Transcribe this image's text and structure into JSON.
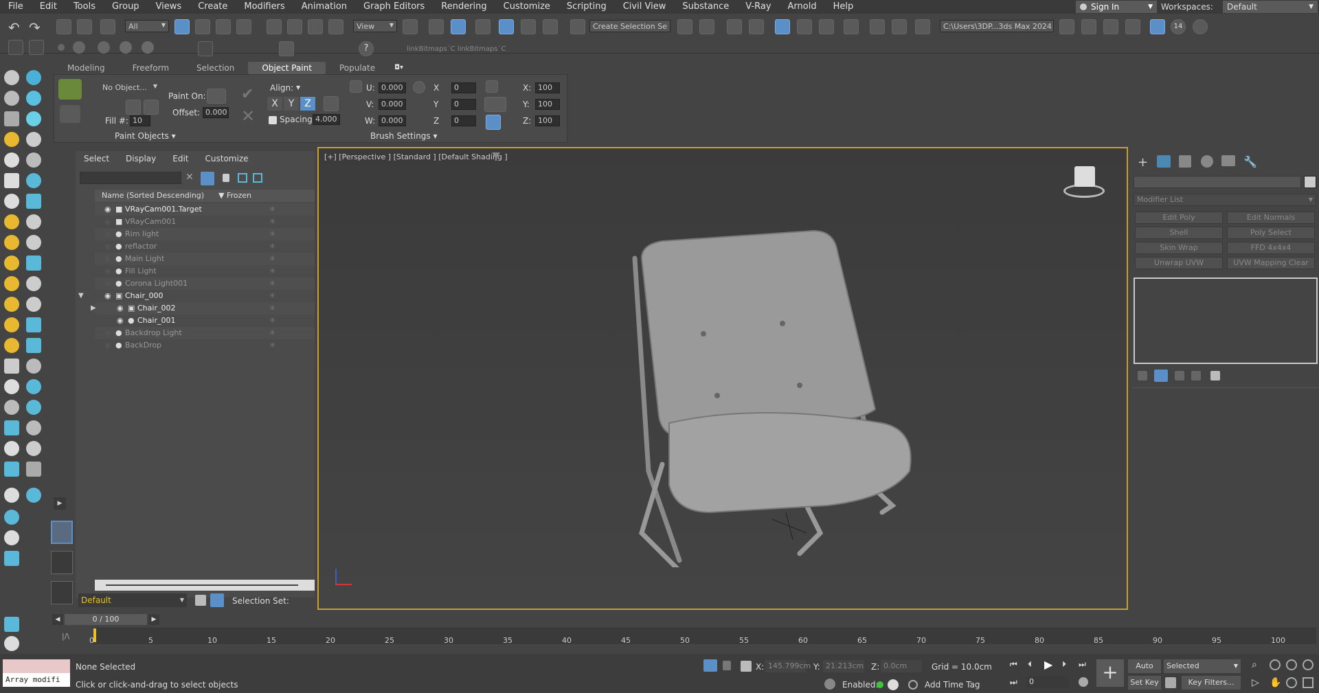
{
  "menu": [
    "File",
    "Edit",
    "Tools",
    "Group",
    "Views",
    "Create",
    "Modifiers",
    "Animation",
    "Graph Editors",
    "Rendering",
    "Customize",
    "Scripting",
    "Civil View",
    "Substance",
    "V-Ray",
    "Arnold",
    "Help"
  ],
  "account": {
    "sign_in": "Sign In",
    "workspaces_label": "Workspaces:",
    "workspace": "Default"
  },
  "toolbar": {
    "filter": "All",
    "view": "View",
    "selection_set": "Create Selection Se",
    "path": "C:\\Users\\3DP...3ds Max 2024",
    "link_bitmaps": "linkBitmaps´C linkBitmaps´C",
    "count_badge": "14"
  },
  "ribbon": {
    "tabs": [
      "Modeling",
      "Freeform",
      "Selection",
      "Object Paint",
      "Populate"
    ],
    "no_object": "No Object...",
    "paint_on": "Paint On:",
    "offset_label": "Offset:",
    "offset": "0.000",
    "fill_label": "Fill #:",
    "fill": "10",
    "align_label": "Align:",
    "axes": [
      "X",
      "Y",
      "Z"
    ],
    "spacing_label": "Spacing:",
    "spacing": "4.000",
    "u_label": "U:",
    "u": "0.000",
    "v_label": "V:",
    "v": "0.000",
    "w_label": "W:",
    "w": "0.000",
    "x_label": "X",
    "x": "0",
    "y_label": "Y",
    "y": "0",
    "z_label": "Z",
    "z": "0",
    "sx_label": "X:",
    "sx": "100",
    "sy_label": "Y:",
    "sy": "100",
    "sz_label": "Z:",
    "sz": "100",
    "paint_objects": "Paint Objects ▾",
    "brush_settings": "Brush Settings ▾"
  },
  "explorer": {
    "menus": [
      "Select",
      "Display",
      "Edit",
      "Customize"
    ],
    "col_name": "Name (Sorted Descending)",
    "col_frozen": "▼ Frozen",
    "rows": [
      {
        "name": "VRayCam001.Target",
        "bright": true
      },
      {
        "name": "VRayCam001",
        "bright": false
      },
      {
        "name": "Rim light",
        "bright": false
      },
      {
        "name": "reflactor",
        "bright": false
      },
      {
        "name": "Main Light",
        "bright": false
      },
      {
        "name": "Fill Light",
        "bright": false
      },
      {
        "name": "Corona Light001",
        "bright": false
      },
      {
        "name": "Chair_000",
        "bright": true
      },
      {
        "name": "Chair_002",
        "bright": true
      },
      {
        "name": "Chair_001",
        "bright": true
      },
      {
        "name": "Backdrop Light",
        "bright": false
      },
      {
        "name": "BackDrop",
        "bright": false
      }
    ],
    "layer": "Default",
    "selection_set_label": "Selection Set:"
  },
  "viewport": {
    "label": "[+] [Perspective ] [Standard ] [Default Shading ]"
  },
  "command_panel": {
    "modifier_list": "Modifier List",
    "buttons": [
      "Edit Poly",
      "Edit Normals",
      "Shell",
      "Poly Select",
      "Skin Wrap",
      "FFD 4x4x4",
      "Unwrap UVW",
      "UVW Mapping Clear"
    ]
  },
  "timeline": {
    "frame": "0 / 100",
    "ticks": [
      "0",
      "5",
      "10",
      "15",
      "20",
      "25",
      "30",
      "35",
      "40",
      "45",
      "50",
      "55",
      "60",
      "65",
      "70",
      "75",
      "80",
      "85",
      "90",
      "95",
      "100"
    ]
  },
  "status": {
    "script_listener": "Array modifi",
    "selection": "None Selected",
    "prompt": "Click or click-and-drag to select objects",
    "x_label": "X:",
    "x": "145.799cm",
    "y_label": "Y:",
    "y": "21.213cm",
    "z_label": "Z:",
    "z": "0.0cm",
    "grid": "Grid = 10.0cm",
    "enabled": "Enabled:",
    "add_time_tag": "Add Time Tag",
    "auto_key": "Auto Key",
    "set_key": "Set Key",
    "key_mode": "Selected",
    "key_filters": "Key Filters...",
    "frame_field": "0"
  },
  "colors": {
    "accent": "#5b8fc7",
    "viewport_border": "#c8a02e",
    "frame_marker": "#f0c020"
  }
}
